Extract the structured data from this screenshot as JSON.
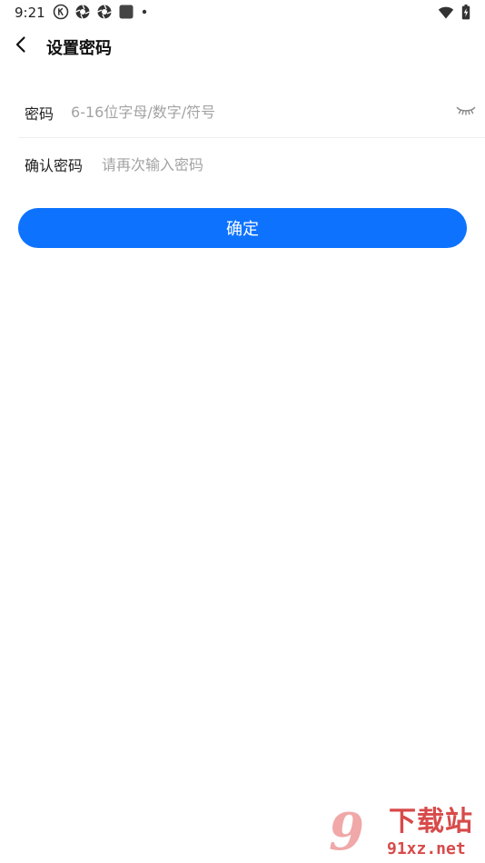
{
  "status_bar": {
    "time": "9:21",
    "icons": [
      "k-circle-icon",
      "aperture-icon",
      "aperture-icon",
      "app-square-icon",
      "dot-icon"
    ],
    "right_icons": [
      "wifi-icon",
      "battery-charging-icon"
    ]
  },
  "nav": {
    "title": "设置密码"
  },
  "form": {
    "password": {
      "label": "密码",
      "value": "",
      "placeholder": "6-16位字母/数字/符号"
    },
    "confirm_password": {
      "label": "确认密码",
      "value": "",
      "placeholder": "请再次输入密码"
    }
  },
  "actions": {
    "confirm_label": "确定"
  },
  "watermark": {
    "mark": "9",
    "site_name": "下载站",
    "url": "91xz.net"
  },
  "colors": {
    "primary": "#0d73ff",
    "placeholder": "#a3a3a3",
    "divider": "#eeeeee"
  }
}
